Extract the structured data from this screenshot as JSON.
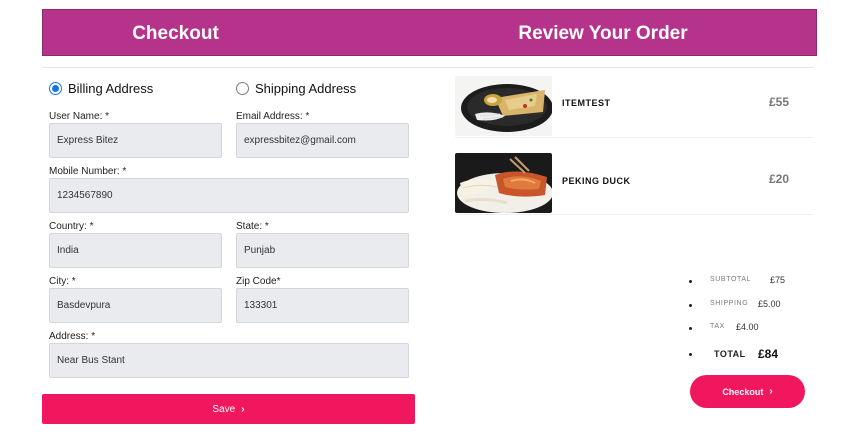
{
  "header": {
    "checkout_title": "Checkout",
    "review_title": "Review Your Order"
  },
  "address_type": {
    "billing_label": "Billing Address",
    "shipping_label": "Shipping Address",
    "selected": "billing"
  },
  "form": {
    "user_name": {
      "label": "User Name: *",
      "value": "Express Bitez"
    },
    "email": {
      "label": "Email Address: *",
      "value": "expressbitez@gmail.com"
    },
    "mobile": {
      "label": "Mobile Number: *",
      "value": "1234567890"
    },
    "country": {
      "label": "Country: *",
      "value": "India"
    },
    "state": {
      "label": "State: *",
      "value": "Punjab"
    },
    "city": {
      "label": "City: *",
      "value": "Basdevpura"
    },
    "zip": {
      "label": "Zip Code*",
      "value": "133301"
    },
    "address": {
      "label": "Address: *",
      "value": "Near Bus Stant"
    },
    "save_label": "Save"
  },
  "order": {
    "items": [
      {
        "name": "ITEMTEST",
        "price": "£55"
      },
      {
        "name": "PEKING DUCK",
        "price": "£20"
      }
    ]
  },
  "summary": {
    "subtotal_label": "SUBTOTAL",
    "subtotal_value": "£75",
    "shipping_label": "SHIPPING",
    "shipping_value": "£5.00",
    "tax_label": "TAX",
    "tax_value": "£4.00",
    "total_label": "TOTAL",
    "total_value": "£84"
  },
  "checkout_button": {
    "label": "Checkout"
  },
  "colors": {
    "header": "#b5338a",
    "accent": "#f1175f",
    "radio": "#1a73e8"
  }
}
